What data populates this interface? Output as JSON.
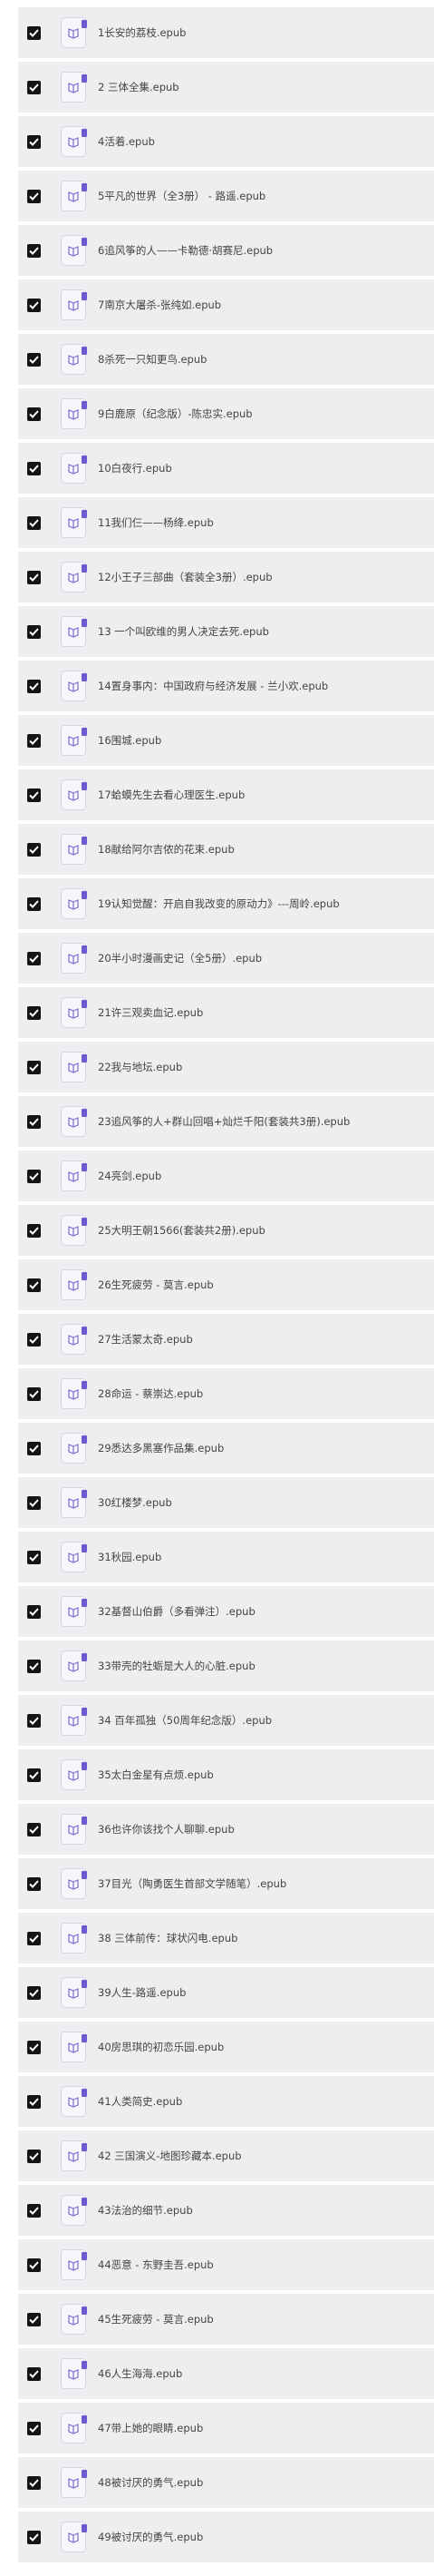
{
  "files": [
    "1长安的荔枝.epub",
    "2 三体全集.epub",
    "4活着.epub",
    "5平凡的世界（全3册） - 路遥.epub",
    "6追风筝的人——卡勒德·胡赛尼.epub",
    "7南京大屠杀-张纯如.epub",
    "8杀死一只知更鸟.epub",
    "9白鹿原（纪念版）-陈忠实.epub",
    "10白夜行.epub",
    "11我们仨——杨绛.epub",
    "12小王子三部曲（套装全3册）.epub",
    "13 一个叫欧维的男人决定去死.epub",
    "14置身事内：中国政府与经济发展 - 兰小欢.epub",
    "16围城.epub",
    "17蛤蟆先生去看心理医生.epub",
    "18献给阿尔吉侬的花束.epub",
    "19认知觉醒：开启自我改变的原动力》---周岭.epub",
    "20半小时漫画史记（全5册）.epub",
    "21许三观卖血记.epub",
    "22我与地坛.epub",
    "23追风筝的人+群山回唱+灿烂千阳(套装共3册).epub",
    "24亮剑.epub",
    "25大明王朝1566(套装共2册).epub",
    "26生死疲劳 - 莫言.epub",
    "27生活蒙太奇.epub",
    "28命运 - 蔡崇达.epub",
    "29悉达多黑塞作品集.epub",
    "30红楼梦.epub",
    "31秋园.epub",
    "32基督山伯爵（多看弹注）.epub",
    "33带壳的牡蛎是大人的心脏.epub",
    "34 百年孤独（50周年纪念版）.epub",
    "35太白金星有点烦.epub",
    "36也许你该找个人聊聊.epub",
    "37目光（陶勇医生首部文学随笔）.epub",
    "38 三体前传：球状闪电.epub",
    "39人生-路遥.epub",
    "40房思琪的初恋乐园.epub",
    "41人类简史.epub",
    "42 三国演义-地图珍藏本.epub",
    "43法治的细节.epub",
    "44恶意 - 东野圭吾.epub",
    "45生死疲劳 - 莫言.epub",
    "46人生海海.epub",
    "47带上她的眼睛.epub",
    "48被讨厌的勇气.epub",
    "49被讨厌的勇气.epub"
  ],
  "colors": {
    "row_bg": "#eeeef0",
    "checkbox_bg": "#141414",
    "icon_accent": "#6b5acd"
  },
  "icons": {
    "checkbox": "checked-checkbox-icon",
    "file": "ebook-file-icon"
  }
}
